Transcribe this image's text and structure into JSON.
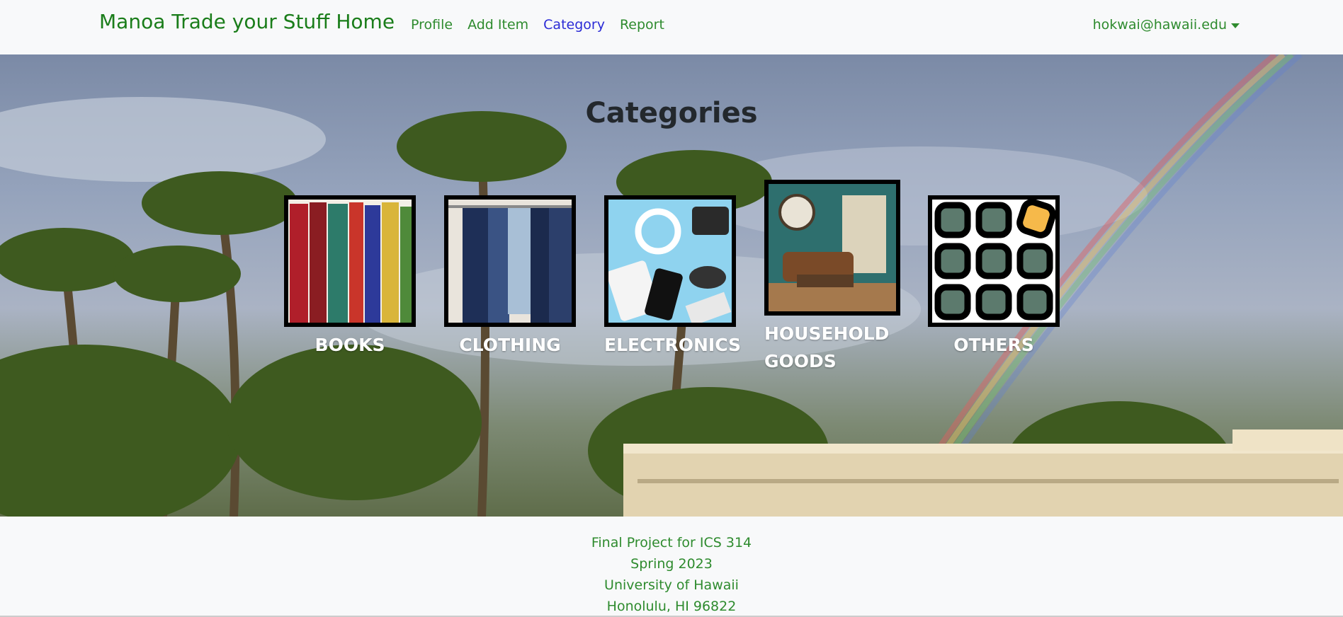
{
  "navbar": {
    "brand": "Manoa Trade your Stuff Home",
    "links": [
      {
        "label": "Profile"
      },
      {
        "label": "Add Item"
      },
      {
        "label": "Category"
      },
      {
        "label": "Report"
      }
    ],
    "user": "hokwai@hawaii.edu"
  },
  "main": {
    "title": "Categories",
    "categories": [
      {
        "label": "BOOKS"
      },
      {
        "label": "CLOTHING"
      },
      {
        "label": "ELECTRONICS"
      },
      {
        "label": "HOUSEHOLD GOODS"
      },
      {
        "label": "OTHERS"
      }
    ]
  },
  "footer": {
    "line1": "Final Project for ICS 314",
    "line2": "Spring 2023",
    "line3": "University of Hawaii",
    "line4": "Honolulu, HI 96822"
  },
  "colors": {
    "brand_green": "#1a7d1a",
    "link_green": "#2e8b2e",
    "active_link": "#2b2bd6"
  }
}
